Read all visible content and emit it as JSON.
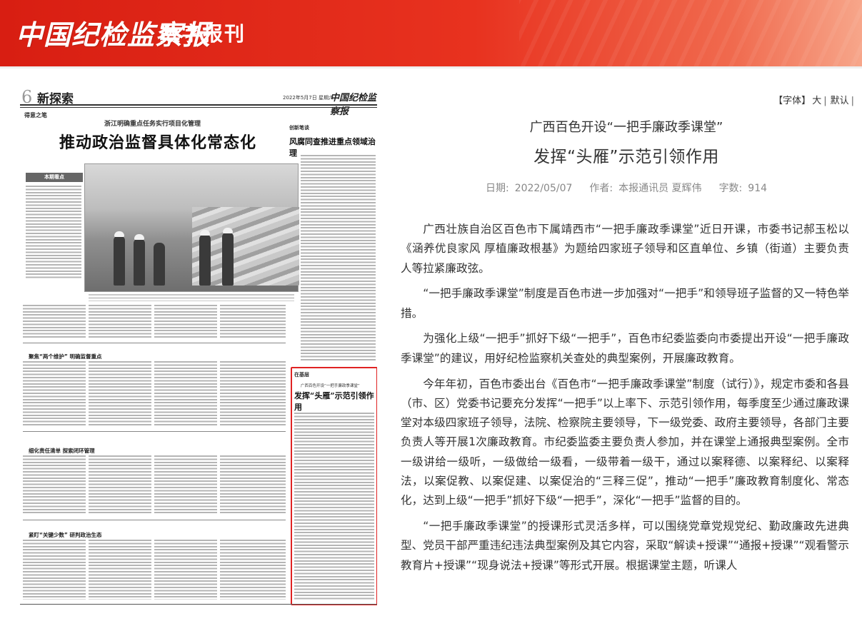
{
  "header": {
    "logo_text": "中国纪检监察报",
    "subtitle": "数字报刊"
  },
  "newspaper_page": {
    "page_number": "6",
    "section_name": "新探索",
    "date_line": "2022年5月7日  星期六",
    "masthead": "中国纪检监察报",
    "column_tag_left": "得意之笔",
    "kicker": "浙江明确重点任务实行项目化管理",
    "headline": "推动政治监督具体化常态化",
    "box_label": "本期看点",
    "right_column_tag": "创新笔谈",
    "right_column_title": "风腐同查推进重点领域治理",
    "subhead_1": "聚焦“两个维护” 明确监督重点",
    "subhead_2": "细化责任清单 探索闭环管理",
    "subhead_3": "紧盯“关键少数” 研判政治生态",
    "highlight": {
      "tag": "在基层",
      "kicker": "广西百色开设“一把手廉政季课堂”",
      "title": "发挥“头雁”示范引领作用"
    }
  },
  "article": {
    "font_controls": {
      "label": "【字体】",
      "large": "大",
      "default": "默认"
    },
    "kicker": "广西百色开设“一把手廉政季课堂”",
    "title": "发挥“头雁”示范引领作用",
    "meta": {
      "date_label": "日期:",
      "date": "2022/05/07",
      "author_label": "作者:",
      "author": "本报通讯员 夏辉伟",
      "wordcount_label": "字数:",
      "wordcount": "914"
    },
    "paragraphs": [
      "广西壮族自治区百色市下属靖西市“一把手廉政季课堂”近日开课，市委书记郝玉松以《涵养优良家风 厚植廉政根基》为题给四家班子领导和区直单位、乡镇（街道）主要负责人等拉紧廉政弦。",
      "“一把手廉政季课堂”制度是百色市进一步加强对“一把手”和领导班子监督的又一特色举措。",
      "为强化上级“一把手”抓好下级“一把手”，百色市纪委监委向市委提出开设“一把手廉政季课堂”的建议，用好纪检监察机关查处的典型案例，开展廉政教育。",
      "今年年初，百色市委出台《百色市“一把手廉政季课堂”制度（试行）》，规定市委和各县（市、区）党委书记要充分发挥“一把手”以上率下、示范引领作用，每季度至少通过廉政课堂对本级四家班子领导，法院、检察院主要领导，下一级党委、政府主要领导，各部门主要负责人等开展1次廉政教育。市纪委监委主要负责人参加，并在课堂上通报典型案例。全市一级讲给一级听，一级做给一级看，一级带着一级干，通过以案释德、以案释纪、以案释法，以案促教、以案促建、以案促治的“三释三促”，推动“一把手”廉政教育制度化、常态化，达到上级“一把手”抓好下级“一把手”，深化“一把手”监督的目的。",
      "“一把手廉政季课堂”的授课形式灵活多样，可以围绕党章党规党纪、勤政廉政先进典型、党员干部严重违纪违法典型案例及其它内容，采取“解读+授课”“通报+授课”“观看警示教育片+授课”“现身说法+授课”等形式开展。根据课堂主题，听课人"
    ]
  }
}
